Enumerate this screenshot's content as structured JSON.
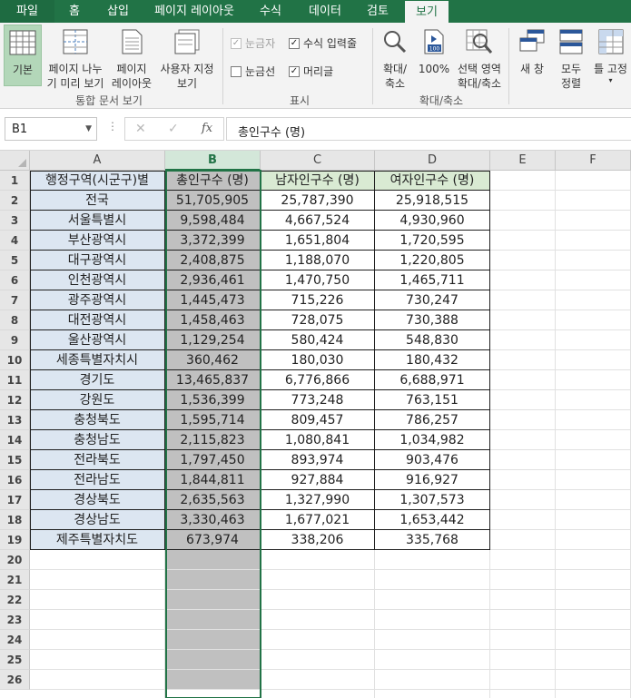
{
  "tabs": [
    {
      "label": "파일"
    },
    {
      "label": "홈"
    },
    {
      "label": "삽입"
    },
    {
      "label": "페이지 레이아웃"
    },
    {
      "label": "수식"
    },
    {
      "label": "데이터"
    },
    {
      "label": "검토"
    },
    {
      "label": "보기"
    }
  ],
  "active_tab": "보기",
  "ribbon": {
    "workbook_views": {
      "group_label": "통합 문서 보기",
      "normal": "기본",
      "page_break_1": "페이지 나누",
      "page_break_2": "기 미리 보기",
      "page_layout_1": "페이지",
      "page_layout_2": "레이아웃",
      "custom_1": "사용자 지정",
      "custom_2": "보기"
    },
    "show": {
      "group_label": "표시",
      "ruler": "눈금자",
      "ruler_checked": true,
      "ruler_disabled": true,
      "formula_bar": "수식 입력줄",
      "formula_bar_checked": true,
      "gridlines": "눈금선",
      "gridlines_checked": false,
      "headings": "머리글",
      "headings_checked": true
    },
    "zoom": {
      "group_label": "확대/축소",
      "zoom_1": "확대/",
      "zoom_2": "축소",
      "zoom100": "100%",
      "zoom_sel_1": "선택 영역",
      "zoom_sel_2": "확대/축소"
    },
    "window": {
      "new_window_1": "새 창",
      "arrange_1": "모두",
      "arrange_2": "정렬",
      "freeze_1": "틀 고정"
    }
  },
  "formula_bar": {
    "name_box": "B1",
    "fx_label": "fx",
    "content": "총인구수 (명)"
  },
  "columns": [
    "A",
    "B",
    "C",
    "D",
    "E",
    "F"
  ],
  "selected_column": "B",
  "row_numbers": [
    "1",
    "2",
    "3",
    "4",
    "5",
    "6",
    "7",
    "8",
    "9",
    "10",
    "11",
    "12",
    "13",
    "14",
    "15",
    "16",
    "17",
    "18",
    "19",
    "20",
    "21",
    "22",
    "23",
    "24",
    "25",
    "26"
  ],
  "table": {
    "headers": [
      "행정구역(시군구)별",
      "총인구수 (명)",
      "남자인구수 (명)",
      "여자인구수 (명)"
    ],
    "rows": [
      [
        "전국",
        "51,705,905",
        "25,787,390",
        "25,918,515"
      ],
      [
        "서울특별시",
        "9,598,484",
        "4,667,524",
        "4,930,960"
      ],
      [
        "부산광역시",
        "3,372,399",
        "1,651,804",
        "1,720,595"
      ],
      [
        "대구광역시",
        "2,408,875",
        "1,188,070",
        "1,220,805"
      ],
      [
        "인천광역시",
        "2,936,461",
        "1,470,750",
        "1,465,711"
      ],
      [
        "광주광역시",
        "1,445,473",
        "715,226",
        "730,247"
      ],
      [
        "대전광역시",
        "1,458,463",
        "728,075",
        "730,388"
      ],
      [
        "울산광역시",
        "1,129,254",
        "580,424",
        "548,830"
      ],
      [
        "세종특별자치시",
        "360,462",
        "180,030",
        "180,432"
      ],
      [
        "경기도",
        "13,465,837",
        "6,776,866",
        "6,688,971"
      ],
      [
        "강원도",
        "1,536,399",
        "773,248",
        "763,151"
      ],
      [
        "충청북도",
        "1,595,714",
        "809,457",
        "786,257"
      ],
      [
        "충청남도",
        "2,115,823",
        "1,080,841",
        "1,034,982"
      ],
      [
        "전라북도",
        "1,797,450",
        "893,974",
        "903,476"
      ],
      [
        "전라남도",
        "1,844,811",
        "927,884",
        "916,927"
      ],
      [
        "경상북도",
        "2,635,563",
        "1,327,990",
        "1,307,573"
      ],
      [
        "경상남도",
        "3,330,463",
        "1,677,021",
        "1,653,442"
      ],
      [
        "제주특별자치도",
        "673,974",
        "338,206",
        "335,768"
      ]
    ]
  }
}
